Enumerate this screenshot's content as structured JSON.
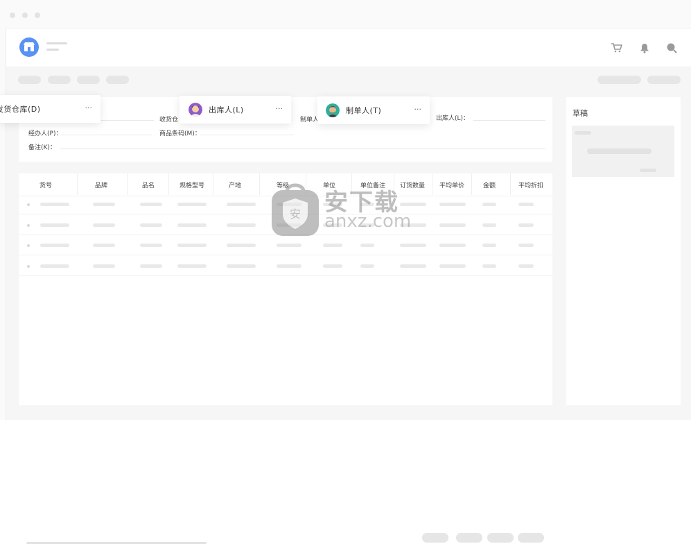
{
  "header": {
    "icons": [
      "cart-icon",
      "bell-icon",
      "search-icon"
    ]
  },
  "form": {
    "receiving_warehouse_label": "收货仓",
    "maker_label": "制单人",
    "outbound_person_label": "出库人(L)：",
    "handler_label": "经办人(P)：",
    "barcode_label": "商品条码(M)：",
    "remark_label": "备注(K)："
  },
  "floating_cards": [
    {
      "label": "发货仓库(D)",
      "more": "···"
    },
    {
      "label": "出库人(L)",
      "more": "···",
      "avatar": "female-avatar"
    },
    {
      "label": "制单人(T)",
      "more": "···",
      "avatar": "male-avatar"
    }
  ],
  "table": {
    "headers": [
      "货号",
      "品牌",
      "品名",
      "规格型号",
      "产地",
      "等级",
      "单位",
      "单位备注",
      "订货数量",
      "平均单价",
      "金额",
      "平均折扣"
    ],
    "row_count": 4
  },
  "draft": {
    "title": "草稿"
  },
  "watermark": {
    "cn": "安下载",
    "en": "anxz.com"
  },
  "colors": {
    "accent": "#5a92f3",
    "background": "#f6f6f6"
  }
}
